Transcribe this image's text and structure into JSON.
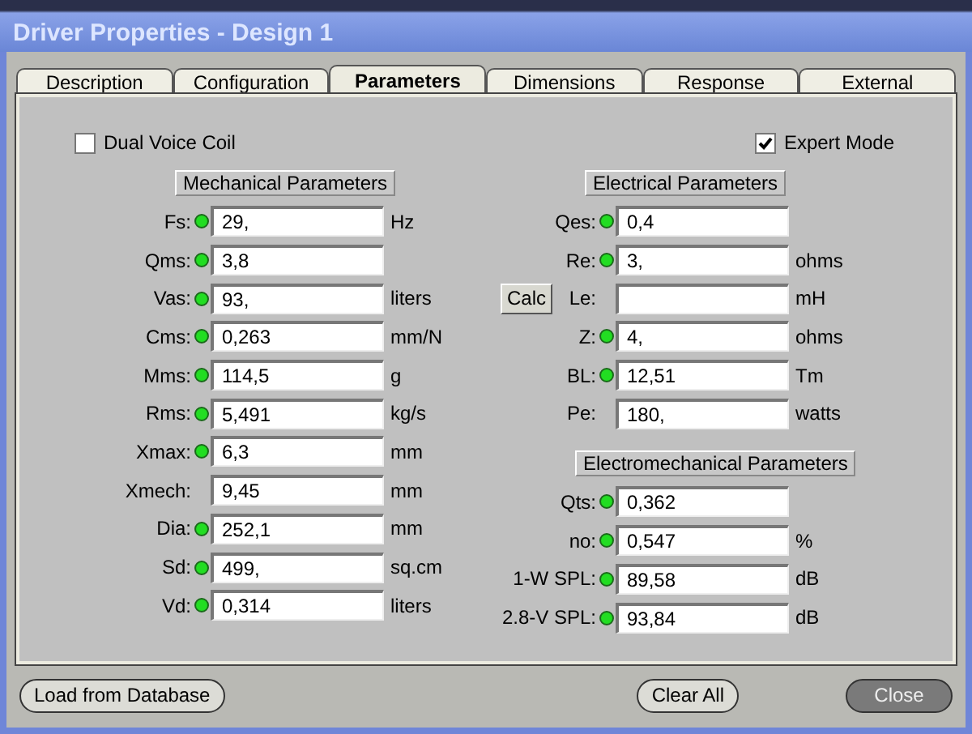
{
  "window": {
    "title": "Driver Properties - Design 1"
  },
  "tabs": [
    {
      "label": "Description",
      "selected": false
    },
    {
      "label": "Configuration",
      "selected": false
    },
    {
      "label": "Parameters",
      "selected": true
    },
    {
      "label": "Dimensions",
      "selected": false
    },
    {
      "label": "Response",
      "selected": false
    },
    {
      "label": "External",
      "selected": false
    }
  ],
  "options": [
    {
      "label": "Dual Voice Coil",
      "checked": false
    },
    {
      "label": "Expert Mode",
      "checked": true
    }
  ],
  "mechanical": {
    "title": "Mechanical Parameters",
    "rows": [
      {
        "label": "Fs:",
        "indicator": true,
        "value": "29,",
        "unit": "Hz"
      },
      {
        "label": "Qms:",
        "indicator": true,
        "value": "3,8"
      },
      {
        "label": "Vas:",
        "indicator": true,
        "value": "93,",
        "unit": "liters"
      },
      {
        "label": "Cms:",
        "indicator": true,
        "value": "0,263",
        "unit": "mm/N"
      },
      {
        "label": "Mms:",
        "indicator": true,
        "value": "114,5",
        "unit": "g"
      },
      {
        "label": "Rms:",
        "indicator": true,
        "value": "5,491",
        "unit": "kg/s"
      },
      {
        "label": "Xmax:",
        "indicator": true,
        "value": "6,3",
        "unit": "mm"
      },
      {
        "label": "Xmech:",
        "indicator": false,
        "value": "9,45",
        "unit": "mm"
      },
      {
        "label": "Dia:",
        "indicator": true,
        "value": "252,1",
        "unit": "mm"
      },
      {
        "label": "Sd:",
        "indicator": true,
        "value": "499,",
        "unit": "sq.cm"
      },
      {
        "label": "Vd:",
        "indicator": true,
        "value": "0,314",
        "unit": "liters"
      }
    ]
  },
  "electrical": {
    "title": "Electrical Parameters",
    "rows": [
      {
        "label": "Qes:",
        "indicator": true,
        "value": "0,4"
      },
      {
        "label": "Re:",
        "indicator": true,
        "value": "3,",
        "unit": "ohms"
      },
      {
        "label": "Le:",
        "indicator": false,
        "button": "Calc",
        "unit": "mH"
      },
      {
        "label": "Z:",
        "indicator": true,
        "value": "4,",
        "unit": "ohms"
      },
      {
        "label": "BL:",
        "indicator": true,
        "value": "12,51",
        "unit": "Tm"
      },
      {
        "label": "Pe:",
        "indicator": false,
        "value": "180,",
        "unit": "watts"
      }
    ]
  },
  "electromechanical": {
    "title": "Electromechanical Parameters",
    "rows": [
      {
        "label": "Qts:",
        "indicator": true,
        "value": "0,362"
      },
      {
        "label": "no:",
        "indicator": true,
        "value": "0,547",
        "unit": "%"
      },
      {
        "label": "1-W SPL:",
        "indicator": true,
        "value": "89,58",
        "unit": "dB"
      },
      {
        "label": "2.8-V SPL:",
        "indicator": true,
        "value": "93,84",
        "unit": "dB"
      }
    ]
  },
  "buttons": [
    {
      "label": "Load from Database",
      "kind": "normal"
    },
    {
      "label": "Clear All",
      "kind": "normal"
    },
    {
      "label": "Close",
      "kind": "dark"
    }
  ]
}
